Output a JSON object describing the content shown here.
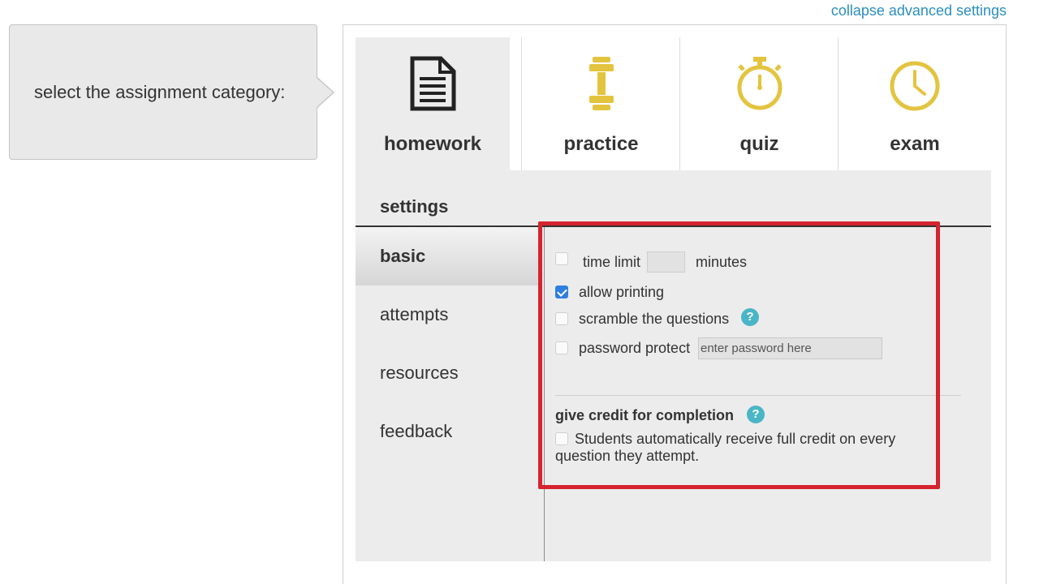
{
  "header": {
    "collapse_link": "collapse advanced settings"
  },
  "prompt": {
    "text": "select the assignment category:"
  },
  "tabs": [
    {
      "label": "homework",
      "icon": "document-icon",
      "active": true
    },
    {
      "label": "practice",
      "icon": "dumbbell-icon",
      "active": false
    },
    {
      "label": "quiz",
      "icon": "stopwatch-icon",
      "active": false
    },
    {
      "label": "exam",
      "icon": "clock-icon",
      "active": false
    }
  ],
  "colors": {
    "accent_gold": "#e3c43f",
    "highlight_red": "#d5232f",
    "link_blue": "#2a8fbd",
    "help_teal": "#4ab5c6",
    "checkbox_blue": "#2f7ee0"
  },
  "settings": {
    "title": "settings",
    "nav": [
      "basic",
      "attempts",
      "resources",
      "feedback"
    ],
    "active_nav": "basic",
    "basic": {
      "time_limit": {
        "label": "time limit",
        "unit": "minutes",
        "value": "",
        "checked": false
      },
      "allow_printing": {
        "label": "allow printing",
        "checked": true
      },
      "scramble": {
        "label": "scramble the questions",
        "checked": false
      },
      "password": {
        "label": "password protect",
        "placeholder": "enter password here",
        "checked": false
      },
      "credit": {
        "title": "give credit for completion",
        "description": "Students automatically receive full credit on every question they attempt.",
        "checked": false
      }
    }
  },
  "help_glyph": "?"
}
